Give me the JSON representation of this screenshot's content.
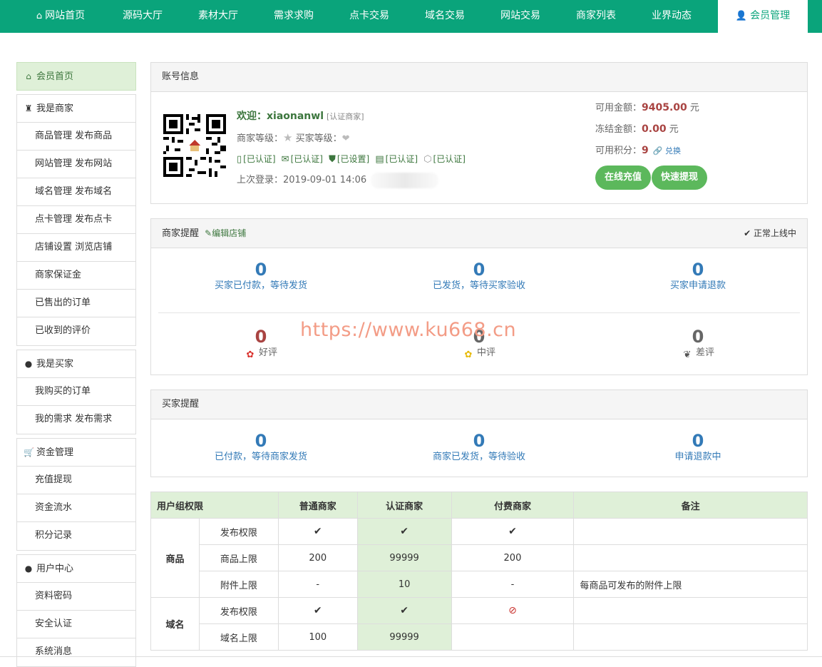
{
  "nav": {
    "items": [
      {
        "label": "网站首页",
        "icon": "home-icon"
      },
      {
        "label": "源码大厅"
      },
      {
        "label": "素材大厅"
      },
      {
        "label": "需求求购"
      },
      {
        "label": "点卡交易"
      },
      {
        "label": "域名交易"
      },
      {
        "label": "网站交易"
      },
      {
        "label": "商家列表"
      },
      {
        "label": "业界动态"
      },
      {
        "label": "会员管理",
        "icon": "user-icon",
        "active": true
      }
    ]
  },
  "sidebar": {
    "home": "会员首页",
    "merchant": {
      "title": "我是商家",
      "items": [
        "商品管理 发布商品",
        "网站管理 发布网站",
        "域名管理 发布域名",
        "点卡管理 发布点卡",
        "店铺设置 浏览店铺",
        "商家保证金",
        "已售出的订单",
        "已收到的评价"
      ]
    },
    "buyer": {
      "title": "我是买家",
      "items": [
        "我购买的订单",
        "我的需求 发布需求"
      ]
    },
    "funds": {
      "title": "资金管理",
      "items": [
        "充值提现",
        "资金流水",
        "积分记录"
      ]
    },
    "user": {
      "title": "用户中心",
      "items": [
        "资料密码",
        "安全认证",
        "系统消息"
      ]
    }
  },
  "account": {
    "title": "账号信息",
    "welcome_prefix": "欢迎：",
    "username": "xiaonanwl",
    "cert_tag": "[认证商家]",
    "seller_level_label": "商家等级：",
    "buyer_level_label": "买家等级：",
    "badges": [
      "[已认证]",
      "[已认证]",
      "[已设置]",
      "[已认证]",
      "[已认证]"
    ],
    "last_login_label": "上次登录：",
    "last_login": "2019-09-01 14:06",
    "available_label": "可用金额：",
    "available": "9405.00",
    "frozen_label": "冻结金额：",
    "frozen": "0.00",
    "unit": "元",
    "points_label": "可用积分：",
    "points": "9",
    "exchange": "兑换",
    "recharge_btn": "在线充值",
    "withdraw_btn": "快速提现"
  },
  "merchant_panel": {
    "title": "商家提醒",
    "edit_shop": "编辑店铺",
    "status": "正常上线中",
    "stats": [
      {
        "value": "0",
        "label": "买家已付款，等待发货"
      },
      {
        "value": "0",
        "label": "已发货，等待买家验收"
      },
      {
        "value": "0",
        "label": "买家申请退款"
      }
    ],
    "reviews": [
      {
        "value": "0",
        "label": "好评"
      },
      {
        "value": "0",
        "label": "中评"
      },
      {
        "value": "0",
        "label": "差评"
      }
    ]
  },
  "watermark": "https://www.ku668.cn",
  "buyer_panel": {
    "title": "买家提醒",
    "stats": [
      {
        "value": "0",
        "label": "已付款，等待商家发货"
      },
      {
        "value": "0",
        "label": "商家已发货，等待验收"
      },
      {
        "value": "0",
        "label": "申请退款中"
      }
    ]
  },
  "perm_table": {
    "headers": [
      "用户组权限",
      "普通商家",
      "认证商家",
      "付费商家",
      "备注"
    ],
    "groups": [
      {
        "category": "商品",
        "rows": [
          {
            "name": "发布权限",
            "normal": "✔",
            "cert": "✔",
            "paid": "✔",
            "note": ""
          },
          {
            "name": "商品上限",
            "normal": "200",
            "cert": "99999",
            "paid": "200",
            "note": ""
          },
          {
            "name": "附件上限",
            "normal": "-",
            "cert": "10",
            "paid": "-",
            "note": "每商品可发布的附件上限"
          }
        ]
      },
      {
        "category": "域名",
        "rows": [
          {
            "name": "发布权限",
            "normal": "✔",
            "cert": "✔",
            "paid": "⃠",
            "note": ""
          },
          {
            "name": "域名上限",
            "normal": "100",
            "cert": "99999",
            "paid": "",
            "note": ""
          }
        ]
      }
    ]
  },
  "colors": {
    "brand": "#0aa47b",
    "accent_green": "#5cb85c",
    "link_blue": "#337ab7",
    "money_red": "#a94442"
  }
}
